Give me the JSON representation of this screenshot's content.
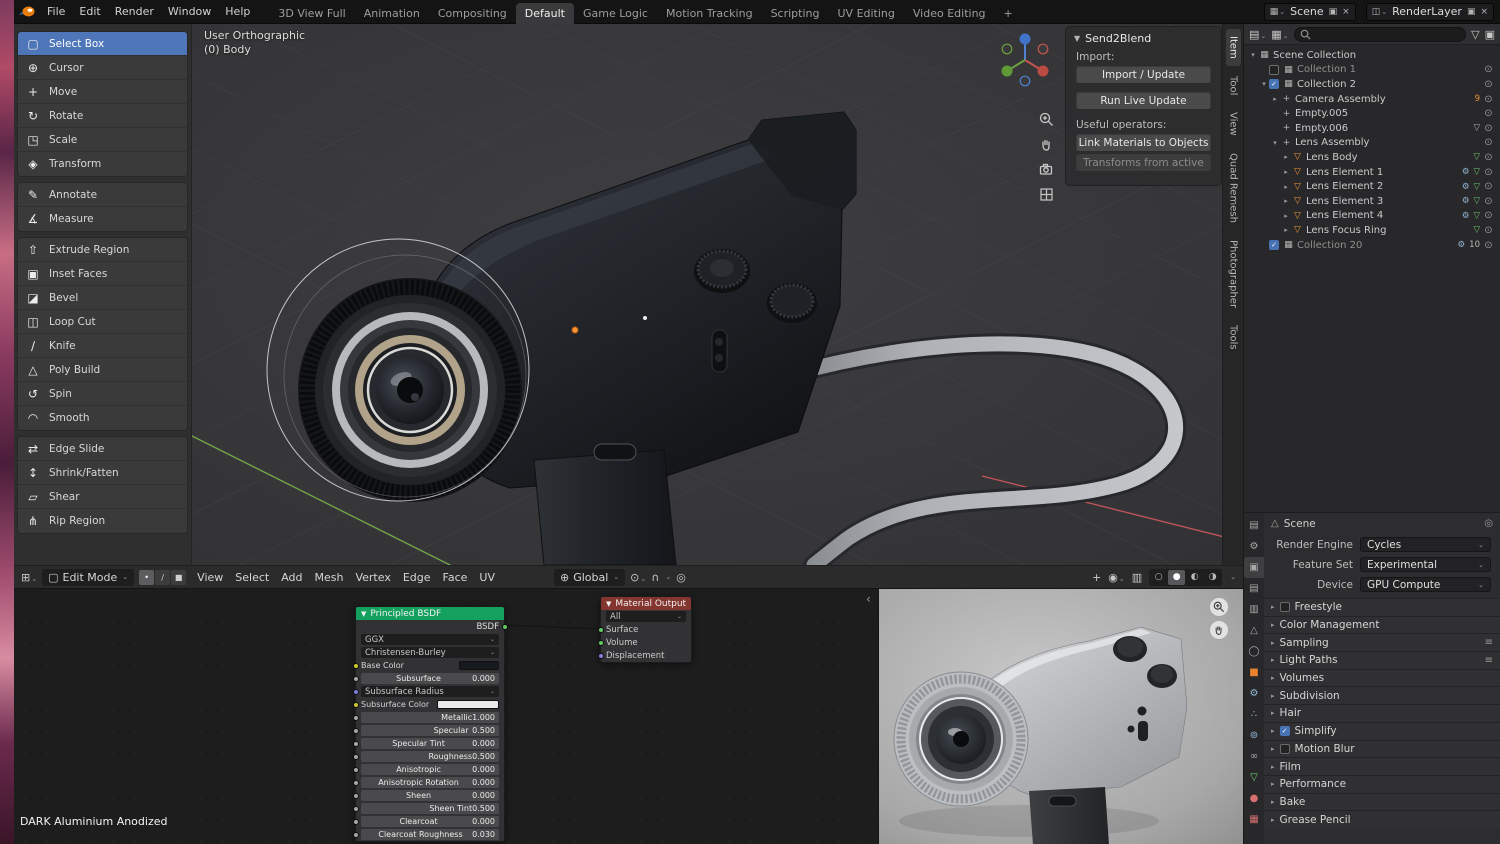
{
  "topbar": {
    "menus": [
      "File",
      "Edit",
      "Render",
      "Window",
      "Help"
    ],
    "workspace_tabs": [
      "3D View Full",
      "Animation",
      "Compositing",
      "Default",
      "Game Logic",
      "Motion Tracking",
      "Scripting",
      "UV Editing",
      "Video Editing",
      "+"
    ],
    "active_tab": "Default",
    "scene_selector": {
      "label": "Scene"
    },
    "render_layer_selector": {
      "label": "RenderLayer"
    }
  },
  "viewport": {
    "overlay": {
      "line1": "User Orthographic",
      "line2": "(0) Body"
    },
    "header": {
      "mode": "Edit Mode",
      "menus": [
        "View",
        "Select",
        "Add",
        "Mesh",
        "Vertex",
        "Edge",
        "Face",
        "UV"
      ],
      "orientation": "Global"
    }
  },
  "toolbar": {
    "active": "Select Box",
    "groups": [
      [
        {
          "label": "Select Box",
          "icon": "select-box-icon"
        },
        {
          "label": "Cursor",
          "icon": "cursor-icon"
        },
        {
          "label": "Move",
          "icon": "move-icon"
        },
        {
          "label": "Rotate",
          "icon": "rotate-icon"
        },
        {
          "label": "Scale",
          "icon": "scale-icon"
        },
        {
          "label": "Transform",
          "icon": "transform-icon"
        }
      ],
      [
        {
          "label": "Annotate",
          "icon": "annotate-icon"
        },
        {
          "label": "Measure",
          "icon": "measure-icon"
        }
      ],
      [
        {
          "label": "Extrude Region",
          "icon": "extrude-region-icon"
        },
        {
          "label": "Inset Faces",
          "icon": "inset-faces-icon"
        },
        {
          "label": "Bevel",
          "icon": "bevel-icon"
        },
        {
          "label": "Loop Cut",
          "icon": "loop-cut-icon"
        },
        {
          "label": "Knife",
          "icon": "knife-icon"
        },
        {
          "label": "Poly Build",
          "icon": "poly-build-icon"
        },
        {
          "label": "Spin",
          "icon": "spin-icon"
        },
        {
          "label": "Smooth",
          "icon": "smooth-icon"
        }
      ],
      [
        {
          "label": "Edge Slide",
          "icon": "edge-slide-icon"
        },
        {
          "label": "Shrink/Fatten",
          "icon": "shrink-fatten-icon"
        },
        {
          "label": "Shear",
          "icon": "shear-icon"
        },
        {
          "label": "Rip Region",
          "icon": "rip-region-icon"
        }
      ]
    ]
  },
  "sidebar": {
    "title": "Send2Blend",
    "import_label": "Import:",
    "import_button": "Import / Update",
    "live_update_button": "Run Live Update",
    "operators_label": "Useful operators:",
    "link_materials_button": "Link Materials to Objects",
    "transforms_button": "Transforms from active",
    "tabs": [
      "Item",
      "Tool",
      "View",
      "Quad Remesh",
      "Photographer",
      "Tools"
    ]
  },
  "outliner": {
    "rows": [
      {
        "indent": 0,
        "twisty": "open",
        "icon": "collection-icon",
        "label": "Scene Collection",
        "eye": false
      },
      {
        "indent": 1,
        "twisty": "none",
        "checkbox": "unchecked",
        "icon": "collection-icon",
        "label": "Collection 1",
        "dim": true,
        "eye": true
      },
      {
        "indent": 1,
        "twisty": "open",
        "checkbox": "checked",
        "icon": "collection-icon",
        "label": "Collection 2",
        "eye": true
      },
      {
        "indent": 2,
        "twisty": "closed",
        "icon": "empty-icon",
        "label": "Camera Assembly",
        "badges": [
          {
            "text": "9",
            "color": "#e8943a"
          }
        ],
        "eye": true
      },
      {
        "indent": 2,
        "twisty": "none",
        "icon": "empty-icon",
        "label": "Empty.005",
        "eye": true
      },
      {
        "indent": 2,
        "twisty": "none",
        "icon": "empty-icon",
        "label": "Empty.006",
        "badges": [
          {
            "icon": "mesh-data-icon",
            "color": "#b8b8b8"
          }
        ],
        "eye": true
      },
      {
        "indent": 2,
        "twisty": "open",
        "icon": "empty-icon",
        "label": "Lens Assembly",
        "eye": true
      },
      {
        "indent": 3,
        "twisty": "closed",
        "icon": "mesh-object-icon",
        "label": "Lens Body",
        "badges": [
          {
            "icon": "mesh-data-icon",
            "color": "#6ec96e"
          }
        ],
        "eye": true
      },
      {
        "indent": 3,
        "twisty": "closed",
        "icon": "mesh-object-icon",
        "label": "Lens Element 1",
        "badges": [
          {
            "icon": "modifier-icon",
            "color": "#93b8d8"
          },
          {
            "icon": "mesh-data-icon",
            "color": "#6ec96e"
          }
        ],
        "eye": true
      },
      {
        "indent": 3,
        "twisty": "closed",
        "icon": "mesh-object-icon",
        "label": "Lens Element 2",
        "badges": [
          {
            "icon": "modifier-icon",
            "color": "#93b8d8"
          },
          {
            "icon": "mesh-data-icon",
            "color": "#6ec96e"
          }
        ],
        "eye": true
      },
      {
        "indent": 3,
        "twisty": "closed",
        "icon": "mesh-object-icon",
        "label": "Lens Element 3",
        "badges": [
          {
            "icon": "modifier-icon",
            "color": "#93b8d8"
          },
          {
            "icon": "mesh-data-icon",
            "color": "#6ec96e"
          }
        ],
        "eye": true
      },
      {
        "indent": 3,
        "twisty": "closed",
        "icon": "mesh-object-icon",
        "label": "Lens Element 4",
        "badges": [
          {
            "icon": "modifier-icon",
            "color": "#93b8d8"
          },
          {
            "icon": "mesh-data-icon",
            "color": "#6ec96e"
          }
        ],
        "eye": true
      },
      {
        "indent": 3,
        "twisty": "closed",
        "icon": "mesh-object-icon",
        "label": "Lens Focus Ring",
        "badges": [
          {
            "icon": "mesh-data-icon",
            "color": "#6ec96e"
          }
        ],
        "eye": true
      },
      {
        "indent": 1,
        "twisty": "none",
        "checkbox": "checked",
        "icon": "collection-icon",
        "label": "Collection 20",
        "dim": true,
        "badges": [
          {
            "icon": "modifier-icon",
            "color": "#93b8d8"
          },
          {
            "text": "10",
            "color": "#b8b8b8"
          }
        ],
        "eye": true
      }
    ]
  },
  "properties": {
    "breadcrumb": "Scene",
    "fields": [
      {
        "label": "Render Engine",
        "value": "Cycles"
      },
      {
        "label": "Feature Set",
        "value": "Experimental"
      },
      {
        "label": "Device",
        "value": "GPU Compute"
      }
    ],
    "sections": [
      {
        "label": "Freestyle",
        "checkbox": "unchecked"
      },
      {
        "label": "Color Management"
      },
      {
        "label": "Sampling",
        "preset": true
      },
      {
        "label": "Light Paths",
        "preset": true
      },
      {
        "label": "Volumes"
      },
      {
        "label": "Subdivision"
      },
      {
        "label": "Hair"
      },
      {
        "label": "Simplify",
        "checkbox": "checked"
      },
      {
        "label": "Motion Blur",
        "checkbox": "unchecked"
      },
      {
        "label": "Film"
      },
      {
        "label": "Performance"
      },
      {
        "label": "Bake"
      },
      {
        "label": "Grease Pencil"
      }
    ],
    "tabs": [
      {
        "icon": "tool-icon",
        "color": "#a8a8a8"
      },
      {
        "icon": "render-icon",
        "color": "#a8a8a8",
        "active": true
      },
      {
        "icon": "output-icon",
        "color": "#a8a8a8"
      },
      {
        "icon": "view-layer-icon",
        "color": "#a8a8a8"
      },
      {
        "icon": "scene-icon",
        "color": "#a8a8a8"
      },
      {
        "icon": "world-icon",
        "color": "#a8a8a8"
      },
      {
        "icon": "object-icon",
        "color": "#e8822e"
      },
      {
        "icon": "modifiers-icon",
        "color": "#93b8d8"
      },
      {
        "icon": "particles-icon",
        "color": "#93b8d8"
      },
      {
        "icon": "physics-icon",
        "color": "#93b8d8"
      },
      {
        "icon": "constraints-icon",
        "color": "#a8a8a8"
      },
      {
        "icon": "object-data-icon",
        "color": "#6ec96e"
      },
      {
        "icon": "material-icon",
        "color": "#d87070"
      },
      {
        "icon": "texture-icon",
        "color": "#d87070"
      }
    ]
  },
  "node_editor": {
    "material_name": "DARK Aluminium Anodized",
    "principled_node": {
      "title": "Principled BSDF",
      "output_socket": "BSDF",
      "distribution": "GGX",
      "subsurface_method": "Christensen-Burley",
      "rows": [
        {
          "label": "Base Color",
          "type": "color",
          "swatch": "#171b20"
        },
        {
          "label": "Subsurface",
          "type": "slider",
          "value": "0.000",
          "fill": 0
        },
        {
          "label": "Subsurface Radius",
          "type": "vector"
        },
        {
          "label": "Subsurface Color",
          "type": "color",
          "swatch": "#e9e9e9",
          "wide": true
        },
        {
          "label": "Metallic",
          "type": "slider",
          "value": "1.000",
          "fill": 100
        },
        {
          "label": "Specular",
          "type": "slider",
          "value": "0.500",
          "fill": 50
        },
        {
          "label": "Specular Tint",
          "type": "slider",
          "value": "0.000",
          "fill": 0
        },
        {
          "label": "Roughness",
          "type": "slider",
          "value": "0.500",
          "fill": 50
        },
        {
          "label": "Anisotropic",
          "type": "slider",
          "value": "0.000",
          "fill": 0
        },
        {
          "label": "Anisotropic Rotation",
          "type": "slider",
          "value": "0.000",
          "fill": 0
        },
        {
          "label": "Sheen",
          "type": "slider",
          "value": "0.000",
          "fill": 0
        },
        {
          "label": "Sheen Tint",
          "type": "slider",
          "value": "0.500",
          "fill": 50
        },
        {
          "label": "Clearcoat",
          "type": "slider",
          "value": "0.000",
          "fill": 0
        },
        {
          "label": "Clearcoat Roughness",
          "type": "slider",
          "value": "0.030",
          "fill": 3
        }
      ]
    },
    "output_node": {
      "title": "Material Output",
      "target": "All",
      "inputs": [
        {
          "label": "Surface",
          "socket_color": "#63c763"
        },
        {
          "label": "Volume",
          "socket_color": "#63c763"
        },
        {
          "label": "Displacement",
          "socket_color": "#8080d8"
        }
      ]
    }
  },
  "colors": {
    "accent": "#4772b3",
    "tool_active": "#4f76b8",
    "bsdf_header": "#14a05f",
    "output_header": "#83352f"
  }
}
